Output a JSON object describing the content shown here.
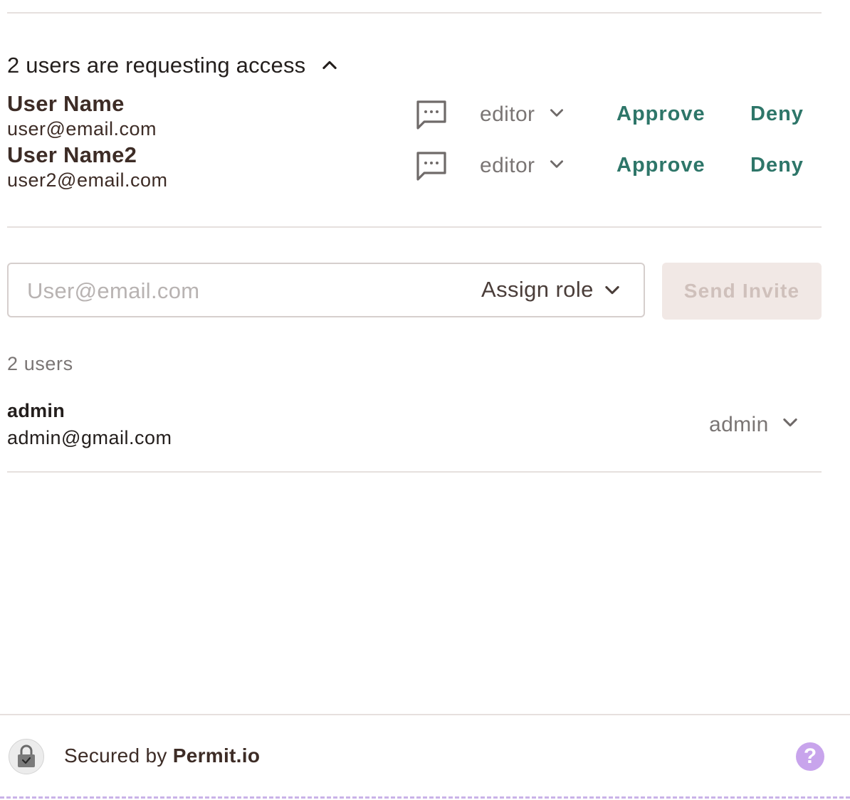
{
  "requests": {
    "title": "2 users are requesting access",
    "items": [
      {
        "name": "User Name",
        "email": "user@email.com",
        "role": "editor",
        "approve": "Approve",
        "deny": "Deny"
      },
      {
        "name": "User Name2",
        "email": "user2@email.com",
        "role": "editor",
        "approve": "Approve",
        "deny": "Deny"
      }
    ]
  },
  "invite": {
    "placeholder": "User@email.com",
    "assign_role": "Assign role",
    "send_label": "Send Invite"
  },
  "members": {
    "count": "2 users",
    "items": [
      {
        "name": "admin",
        "email": "admin@gmail.com",
        "role": "admin"
      }
    ]
  },
  "footer": {
    "secured_prefix": "Secured by",
    "brand": "Permit.io",
    "help": "?"
  },
  "colors": {
    "accent": "#2e7669",
    "help_bg": "#c8a4ec",
    "send_bg": "#f1e8e5"
  }
}
